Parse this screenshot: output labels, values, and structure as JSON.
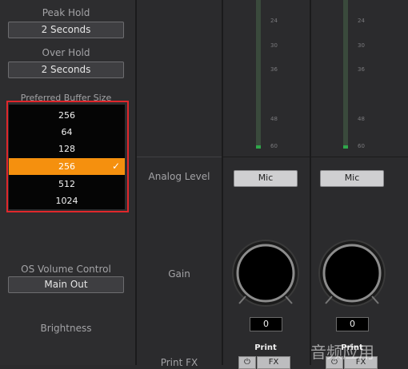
{
  "settings": {
    "peak_hold": {
      "label": "Peak Hold",
      "value": "2 Seconds"
    },
    "over_hold": {
      "label": "Over Hold",
      "value": "2 Seconds"
    },
    "buffer": {
      "label": "Preferred Buffer Size",
      "current": "256"
    },
    "buffer_options": [
      {
        "label": "64"
      },
      {
        "label": "128"
      },
      {
        "label": "256",
        "selected": true,
        "check": "✓"
      },
      {
        "label": "512"
      },
      {
        "label": "1024"
      }
    ],
    "os_volume": {
      "label": "OS Volume Control",
      "value": "Main Out"
    },
    "brightness_label": "Brightness"
  },
  "rows": {
    "analog_level": "Analog Level",
    "gain": "Gain",
    "print_fx": "Print FX"
  },
  "channels": [
    {
      "mic_label": "Mic",
      "gain_value": "0",
      "print_label": "Print",
      "fx_label": "FX",
      "power_icon": "⏻"
    },
    {
      "mic_label": "Mic",
      "gain_value": "0",
      "print_label": "Print",
      "fx_label": "FX",
      "power_icon": "⏻"
    }
  ],
  "meter_scale": [
    "24",
    "30",
    "36",
    "48",
    "60"
  ],
  "watermark": "音频应用",
  "colors": {
    "accent": "#f5900e",
    "highlight": "#e0272b"
  }
}
